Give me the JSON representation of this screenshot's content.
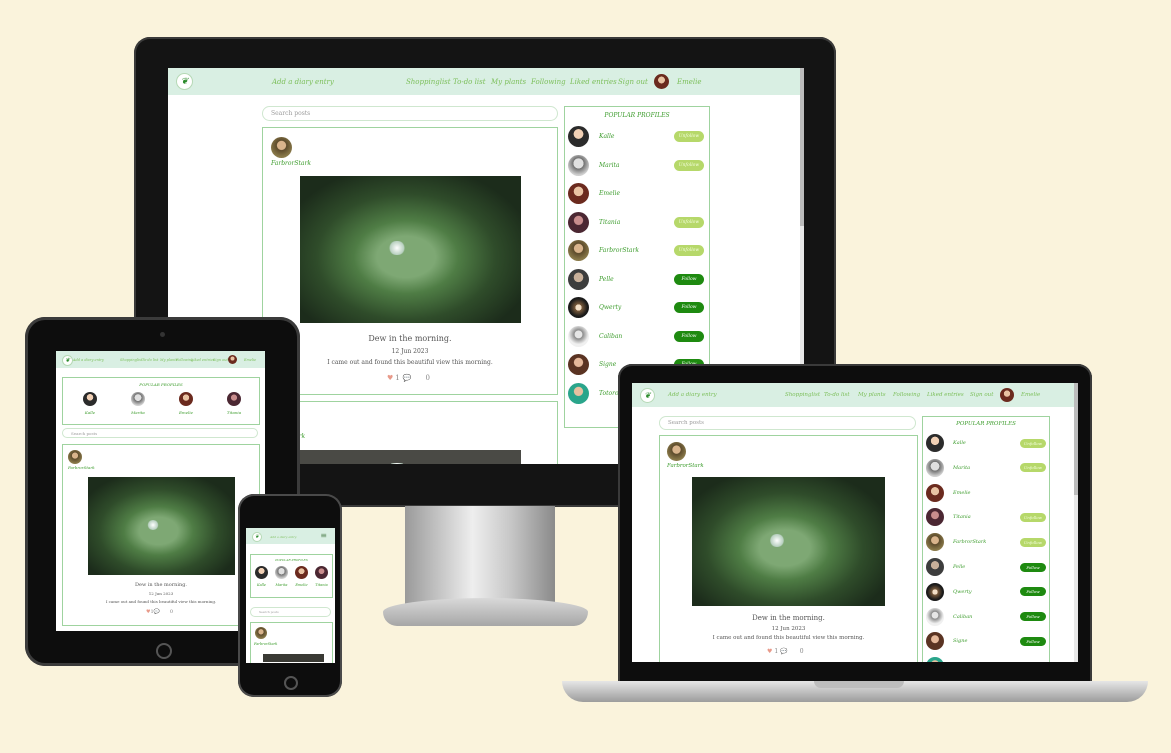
{
  "nav": {
    "add_entry": "Add a diary entry",
    "shoppinglist": "Shoppinglist",
    "todo": "To-do list",
    "myplants": "My plants",
    "following": "Following",
    "liked": "Liked entries",
    "signout": "Sign out",
    "username": "Emelie"
  },
  "search": {
    "placeholder": "Search posts"
  },
  "popular": {
    "title": "POPULAR PROFILES",
    "profiles": [
      {
        "name": "Kalle",
        "button": "Unfollow"
      },
      {
        "name": "Marita",
        "button": "Unfollow"
      },
      {
        "name": "Emelie",
        "button": ""
      },
      {
        "name": "Titania",
        "button": "Unfollow"
      },
      {
        "name": "FarbrorStark",
        "button": "Unfollow"
      },
      {
        "name": "Pelle",
        "button": "Follow"
      },
      {
        "name": "Qwerty",
        "button": "Follow"
      },
      {
        "name": "Caliban",
        "button": "Follow"
      },
      {
        "name": "Signe",
        "button": "Follow"
      },
      {
        "name": "Totoro",
        "button": ""
      }
    ]
  },
  "post": {
    "author": "FarbrorStark",
    "title": "Dew in the morning.",
    "date": "12 Jun 2023",
    "text": "I came out and found this beautiful view this morning.",
    "likes": "1",
    "comments": "0"
  },
  "post2": {
    "author_fragment": "ark"
  },
  "icons": {
    "heart": "heart-icon",
    "comment": "comment-icon",
    "logo": "leaf-logo-icon",
    "menu": "hamburger-menu-icon"
  },
  "colors": {
    "nav_bg": "#d9efe3",
    "accent": "#3c9c2c",
    "follow": "#1e8a10",
    "unfollow": "#b6d86a",
    "background": "#faf3dc"
  }
}
